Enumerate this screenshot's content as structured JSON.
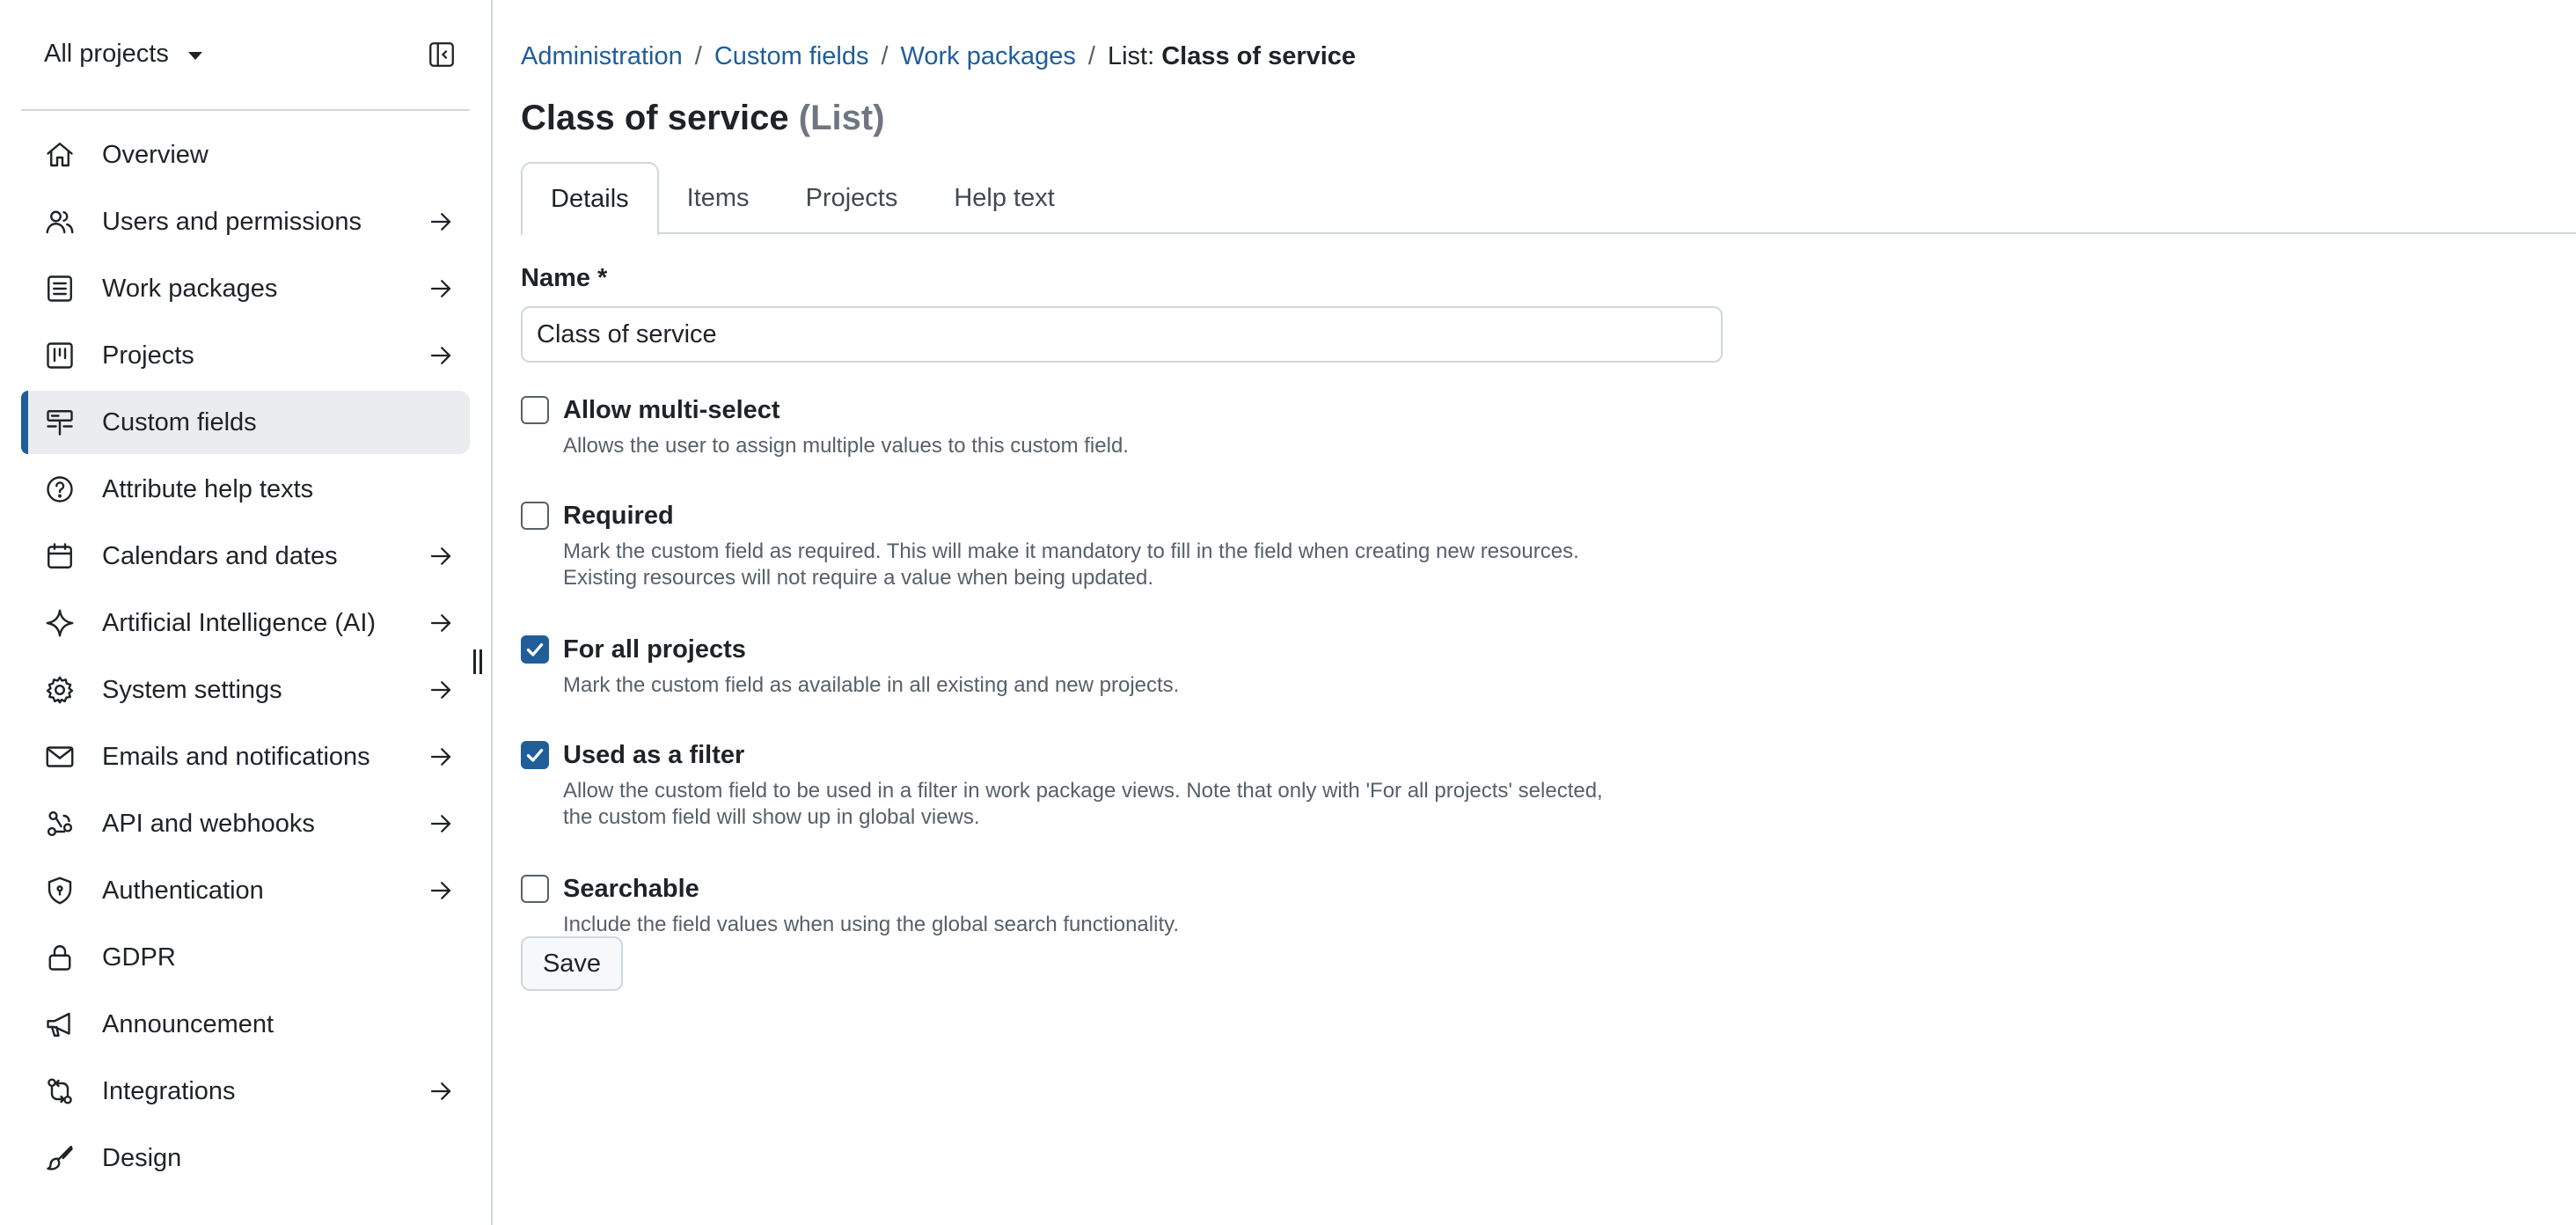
{
  "sidebar": {
    "project_selector": "All projects",
    "items": [
      {
        "label": "Overview",
        "icon": "home-icon",
        "has_arrow": false,
        "active": false
      },
      {
        "label": "Users and permissions",
        "icon": "people-icon",
        "has_arrow": true,
        "active": false
      },
      {
        "label": "Work packages",
        "icon": "list-icon",
        "has_arrow": true,
        "active": false
      },
      {
        "label": "Projects",
        "icon": "board-icon",
        "has_arrow": true,
        "active": false
      },
      {
        "label": "Custom fields",
        "icon": "custom-field-icon",
        "has_arrow": false,
        "active": true
      },
      {
        "label": "Attribute help texts",
        "icon": "question-icon",
        "has_arrow": false,
        "active": false
      },
      {
        "label": "Calendars and dates",
        "icon": "calendar-icon",
        "has_arrow": true,
        "active": false
      },
      {
        "label": "Artificial Intelligence (AI)",
        "icon": "sparkle-icon",
        "has_arrow": true,
        "active": false
      },
      {
        "label": "System settings",
        "icon": "gear-icon",
        "has_arrow": true,
        "active": false
      },
      {
        "label": "Emails and notifications",
        "icon": "mail-icon",
        "has_arrow": true,
        "active": false
      },
      {
        "label": "API and webhooks",
        "icon": "webhook-icon",
        "has_arrow": true,
        "active": false
      },
      {
        "label": "Authentication",
        "icon": "shield-icon",
        "has_arrow": true,
        "active": false
      },
      {
        "label": "GDPR",
        "icon": "lock-icon",
        "has_arrow": false,
        "active": false
      },
      {
        "label": "Announcement",
        "icon": "megaphone-icon",
        "has_arrow": false,
        "active": false
      },
      {
        "label": "Integrations",
        "icon": "integrations-icon",
        "has_arrow": true,
        "active": false
      },
      {
        "label": "Design",
        "icon": "paintbrush-icon",
        "has_arrow": false,
        "active": false
      }
    ]
  },
  "breadcrumb": {
    "items": [
      "Administration",
      "Custom fields",
      "Work packages"
    ],
    "separator": "/",
    "current_prefix": "List:",
    "current_name": "Class of service"
  },
  "page_title": {
    "name": "Class of service",
    "type": "(List)"
  },
  "tabs": [
    {
      "label": "Details",
      "active": true
    },
    {
      "label": "Items",
      "active": false
    },
    {
      "label": "Projects",
      "active": false
    },
    {
      "label": "Help text",
      "active": false
    }
  ],
  "form": {
    "name_label": "Name *",
    "name_value": "Class of service",
    "options": [
      {
        "title": "Allow multi-select",
        "desc": [
          "Allows the user to assign multiple values to this custom field."
        ],
        "checked": false
      },
      {
        "title": "Required",
        "desc": [
          "Mark the custom field as required. This will make it mandatory to fill in the field when creating new resources.",
          "Existing resources will not require a value when being updated."
        ],
        "checked": false
      },
      {
        "title": "For all projects",
        "desc": [
          "Mark the custom field as available in all existing and new projects."
        ],
        "checked": true
      },
      {
        "title": "Used as a filter",
        "desc": [
          "Allow the custom field to be used in a filter in work package views. Note that only with 'For all projects' selected,",
          "the custom field will show up in global views."
        ],
        "checked": true
      },
      {
        "title": "Searchable",
        "desc": [
          "Include the field values when using the global search functionality."
        ],
        "checked": false
      }
    ],
    "save_label": "Save"
  },
  "colors": {
    "accent": "#1f5e99",
    "link": "#1f5e99",
    "active_nav_bg": "#eaecef",
    "border": "#d0d7de"
  }
}
